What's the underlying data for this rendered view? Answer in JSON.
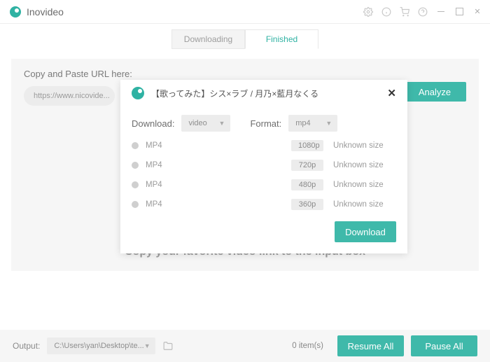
{
  "app": {
    "name": "Inovideo"
  },
  "tabs": {
    "downloading": "Downloading",
    "finished": "Finished"
  },
  "section": {
    "label": "Copy and Paste URL here:",
    "url_placeholder": "https://www.nicovide...",
    "analyze": "Analyze",
    "hint": "Copy your favorite video link to the input box"
  },
  "popup": {
    "title": "【歌ってみた】シス×ラブ / 月乃×藍月なくる",
    "download_label": "Download:",
    "format_label": "Format:",
    "download_select": "video",
    "format_select": "mp4",
    "rows": [
      {
        "codec": "MP4",
        "res": "1080p",
        "size": "Unknown size"
      },
      {
        "codec": "MP4",
        "res": "720p",
        "size": "Unknown size"
      },
      {
        "codec": "MP4",
        "res": "480p",
        "size": "Unknown size"
      },
      {
        "codec": "MP4",
        "res": "360p",
        "size": "Unknown size"
      }
    ],
    "download_btn": "Download"
  },
  "footer": {
    "output_label": "Output:",
    "output_path": "C:\\Users\\yan\\Desktop\\te...",
    "items": "0 item(s)",
    "resume": "Resume All",
    "pause": "Pause All"
  }
}
